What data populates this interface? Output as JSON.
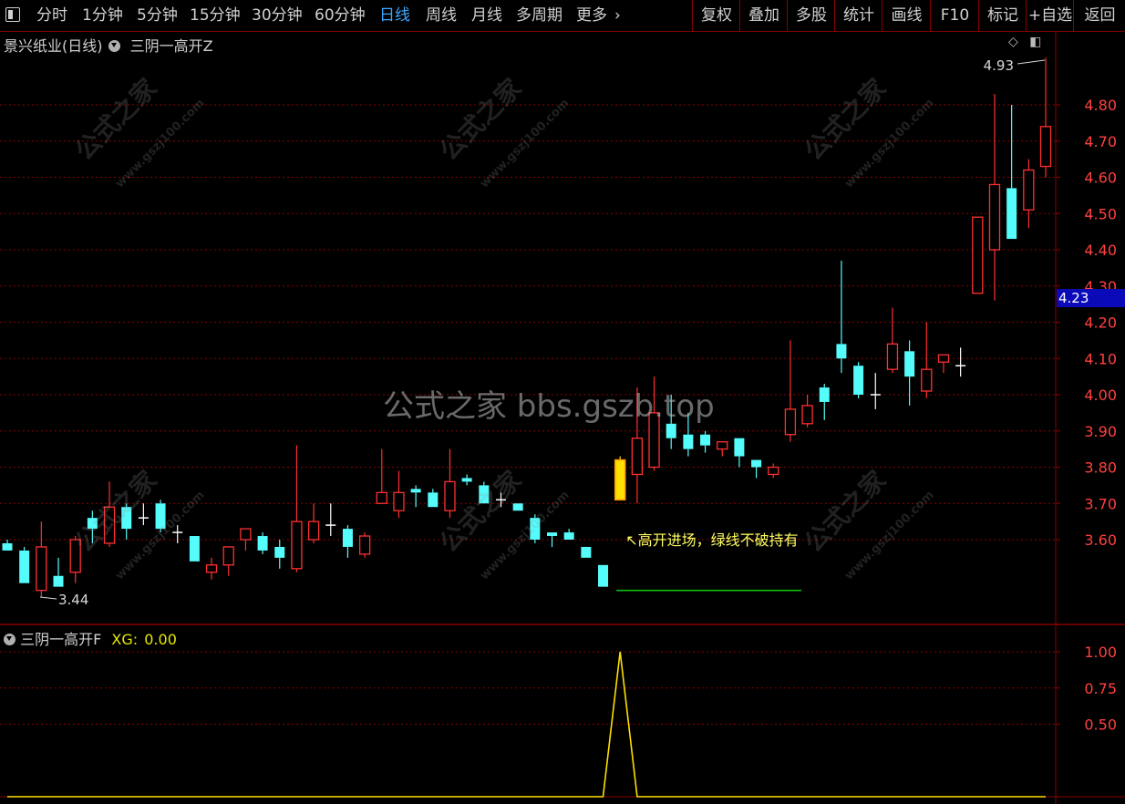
{
  "toolbar": {
    "periods": [
      {
        "label": "分时",
        "x": 40
      },
      {
        "label": "1分钟",
        "x": 90
      },
      {
        "label": "5分钟",
        "x": 150
      },
      {
        "label": "15分钟",
        "x": 208
      },
      {
        "label": "30分钟",
        "x": 276
      },
      {
        "label": "60分钟",
        "x": 345
      },
      {
        "label": "日线",
        "x": 416,
        "active": true
      },
      {
        "label": "周线",
        "x": 467
      },
      {
        "label": "月线",
        "x": 517
      },
      {
        "label": "多周期",
        "x": 566
      },
      {
        "label": "更多",
        "x": 632
      }
    ],
    "more_chevron": "›",
    "right_buttons": [
      {
        "label": "复权"
      },
      {
        "label": "叠加"
      },
      {
        "label": "多股"
      },
      {
        "label": "统计"
      },
      {
        "label": "画线"
      },
      {
        "label": "F10"
      },
      {
        "label": "标记"
      },
      {
        "label": "+自选"
      },
      {
        "label": "返回"
      }
    ]
  },
  "main_panel": {
    "stock_name": "景兴纸业(日线)",
    "indicator_name": "三阴一高开Z",
    "current_price_tag": "4.23",
    "high_marker": "4.93",
    "low_marker": "3.44",
    "annotation": "高开进场，绿线不破持有",
    "watermark_center": "公式之家 bbs.gszb.top",
    "watermark_small": "公式之家",
    "watermark_sub": "www.gszj100.com"
  },
  "indicator_panel": {
    "name": "三阴一高开F",
    "xg_label": "XG:",
    "xg_value": "0.00",
    "y_ticks": [
      "1.00",
      "0.75",
      "0.50"
    ]
  },
  "colors": {
    "up": "#ff3030",
    "down": "#54fcfc",
    "grid": "#8a0000",
    "axis_text": "#ff4040",
    "signal": "#ffe000",
    "support": "#10c010"
  },
  "chart_data": {
    "type": "candlestick",
    "price_ylim": [
      3.4,
      4.95
    ],
    "price_ticks": [
      3.6,
      3.7,
      3.8,
      3.9,
      4.0,
      4.1,
      4.2,
      4.3,
      4.4,
      4.5,
      4.6,
      4.7,
      4.8
    ],
    "candles": [
      {
        "o": 3.59,
        "h": 3.6,
        "l": 3.57,
        "c": 3.57
      },
      {
        "o": 3.57,
        "h": 3.58,
        "l": 3.48,
        "c": 3.48
      },
      {
        "o": 3.46,
        "h": 3.65,
        "l": 3.44,
        "c": 3.58
      },
      {
        "o": 3.5,
        "h": 3.55,
        "l": 3.47,
        "c": 3.47
      },
      {
        "o": 3.51,
        "h": 3.61,
        "l": 3.48,
        "c": 3.6
      },
      {
        "o": 3.66,
        "h": 3.68,
        "l": 3.59,
        "c": 3.63
      },
      {
        "o": 3.59,
        "h": 3.76,
        "l": 3.58,
        "c": 3.69
      },
      {
        "o": 3.69,
        "h": 3.7,
        "l": 3.6,
        "c": 3.63
      },
      {
        "o": 3.66,
        "h": 3.7,
        "l": 3.64,
        "c": 3.66
      },
      {
        "o": 3.7,
        "h": 3.71,
        "l": 3.62,
        "c": 3.63
      },
      {
        "o": 3.62,
        "h": 3.64,
        "l": 3.59,
        "c": 3.62
      },
      {
        "o": 3.61,
        "h": 3.61,
        "l": 3.54,
        "c": 3.54
      },
      {
        "o": 3.51,
        "h": 3.55,
        "l": 3.49,
        "c": 3.53
      },
      {
        "o": 3.53,
        "h": 3.58,
        "l": 3.5,
        "c": 3.58
      },
      {
        "o": 3.6,
        "h": 3.63,
        "l": 3.57,
        "c": 3.63
      },
      {
        "o": 3.61,
        "h": 3.62,
        "l": 3.56,
        "c": 3.57
      },
      {
        "o": 3.58,
        "h": 3.6,
        "l": 3.52,
        "c": 3.55
      },
      {
        "o": 3.52,
        "h": 3.86,
        "l": 3.51,
        "c": 3.65
      },
      {
        "o": 3.6,
        "h": 3.7,
        "l": 3.59,
        "c": 3.65
      },
      {
        "o": 3.64,
        "h": 3.7,
        "l": 3.61,
        "c": 3.64
      },
      {
        "o": 3.63,
        "h": 3.64,
        "l": 3.55,
        "c": 3.58
      },
      {
        "o": 3.56,
        "h": 3.62,
        "l": 3.55,
        "c": 3.61
      },
      {
        "o": 3.7,
        "h": 3.85,
        "l": 3.7,
        "c": 3.73
      },
      {
        "o": 3.68,
        "h": 3.79,
        "l": 3.66,
        "c": 3.73
      },
      {
        "o": 3.74,
        "h": 3.75,
        "l": 3.69,
        "c": 3.73
      },
      {
        "o": 3.73,
        "h": 3.74,
        "l": 3.69,
        "c": 3.69
      },
      {
        "o": 3.68,
        "h": 3.85,
        "l": 3.66,
        "c": 3.76
      },
      {
        "o": 3.77,
        "h": 3.78,
        "l": 3.75,
        "c": 3.76
      },
      {
        "o": 3.75,
        "h": 3.76,
        "l": 3.7,
        "c": 3.7
      },
      {
        "o": 3.71,
        "h": 3.73,
        "l": 3.69,
        "c": 3.71
      },
      {
        "o": 3.7,
        "h": 3.7,
        "l": 3.68,
        "c": 3.68
      },
      {
        "o": 3.66,
        "h": 3.67,
        "l": 3.59,
        "c": 3.6
      },
      {
        "o": 3.62,
        "h": 3.62,
        "l": 3.58,
        "c": 3.61
      },
      {
        "o": 3.62,
        "h": 3.63,
        "l": 3.6,
        "c": 3.6
      },
      {
        "o": 3.58,
        "h": 3.58,
        "l": 3.55,
        "c": 3.55
      },
      {
        "o": 3.53,
        "h": 3.53,
        "l": 3.47,
        "c": 3.47
      },
      {
        "o": 3.71,
        "h": 3.83,
        "l": 3.71,
        "c": 3.82
      },
      {
        "o": 3.78,
        "h": 4.02,
        "l": 3.7,
        "c": 3.88
      },
      {
        "o": 3.8,
        "h": 4.05,
        "l": 3.79,
        "c": 3.95
      },
      {
        "o": 3.92,
        "h": 4.0,
        "l": 3.85,
        "c": 3.88
      },
      {
        "o": 3.89,
        "h": 3.95,
        "l": 3.83,
        "c": 3.85
      },
      {
        "o": 3.89,
        "h": 3.9,
        "l": 3.84,
        "c": 3.86
      },
      {
        "o": 3.85,
        "h": 3.87,
        "l": 3.83,
        "c": 3.87
      },
      {
        "o": 3.88,
        "h": 3.88,
        "l": 3.8,
        "c": 3.83
      },
      {
        "o": 3.82,
        "h": 3.82,
        "l": 3.77,
        "c": 3.8
      },
      {
        "o": 3.78,
        "h": 3.81,
        "l": 3.77,
        "c": 3.8
      },
      {
        "o": 3.89,
        "h": 4.15,
        "l": 3.87,
        "c": 3.96
      },
      {
        "o": 3.92,
        "h": 4.0,
        "l": 3.91,
        "c": 3.97
      },
      {
        "o": 4.02,
        "h": 4.03,
        "l": 3.93,
        "c": 3.98
      },
      {
        "o": 4.14,
        "h": 4.37,
        "l": 4.06,
        "c": 4.1
      },
      {
        "o": 4.08,
        "h": 4.09,
        "l": 3.99,
        "c": 4.0
      },
      {
        "o": 4.0,
        "h": 4.06,
        "l": 3.96,
        "c": 4.0
      },
      {
        "o": 4.07,
        "h": 4.24,
        "l": 4.06,
        "c": 4.14
      },
      {
        "o": 4.12,
        "h": 4.15,
        "l": 3.97,
        "c": 4.05
      },
      {
        "o": 4.01,
        "h": 4.2,
        "l": 3.99,
        "c": 4.07
      },
      {
        "o": 4.09,
        "h": 4.11,
        "l": 4.06,
        "c": 4.11
      },
      {
        "o": 4.08,
        "h": 4.13,
        "l": 4.05,
        "c": 4.08
      },
      {
        "o": 4.28,
        "h": 4.49,
        "l": 4.28,
        "c": 4.49
      },
      {
        "o": 4.4,
        "h": 4.83,
        "l": 4.26,
        "c": 4.58
      },
      {
        "o": 4.57,
        "h": 4.8,
        "l": 4.44,
        "c": 4.43
      },
      {
        "o": 4.51,
        "h": 4.65,
        "l": 4.46,
        "c": 4.62
      },
      {
        "o": 4.63,
        "h": 4.93,
        "l": 4.6,
        "c": 4.74
      }
    ],
    "signal_candle_index": 36,
    "support_line": {
      "value": 3.47,
      "from_index": 36,
      "to_index": 46
    },
    "indicator_series": {
      "name": "XG",
      "values": [
        0,
        0,
        0,
        0,
        0,
        0,
        0,
        0,
        0,
        0,
        0,
        0,
        0,
        0,
        0,
        0,
        0,
        0,
        0,
        0,
        0,
        0,
        0,
        0,
        0,
        0,
        0,
        0,
        0,
        0,
        0,
        0,
        0,
        0,
        0,
        0,
        1,
        0,
        0,
        0,
        0,
        0,
        0,
        0,
        0,
        0,
        0,
        0,
        0,
        0,
        0,
        0,
        0,
        0,
        0,
        0,
        0,
        0,
        0,
        0,
        0,
        0
      ],
      "ylim": [
        0,
        1.1
      ]
    }
  }
}
